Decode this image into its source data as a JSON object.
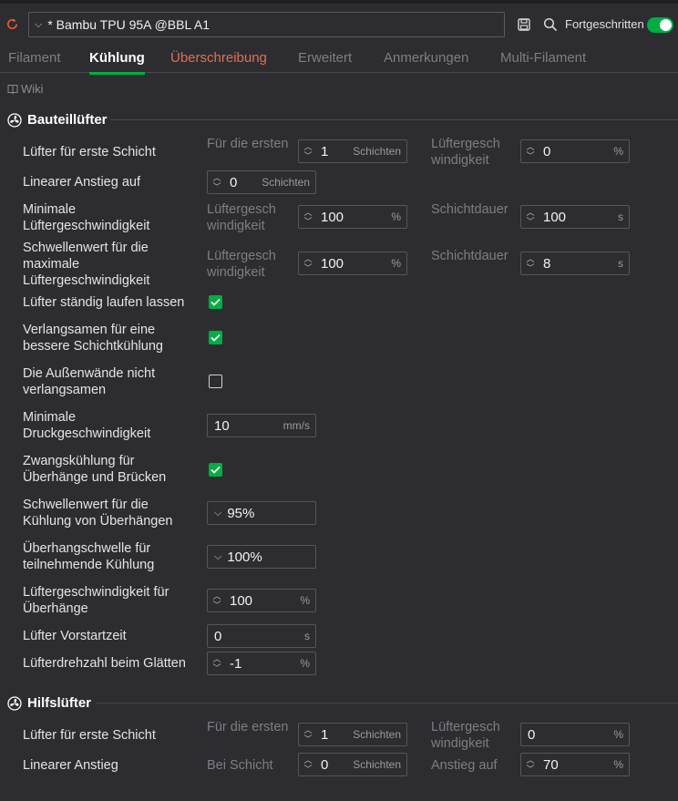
{
  "top": {
    "preset_name": "* Bambu TPU 95A @BBL A1",
    "advanced_label": "Fortgeschritten"
  },
  "tabs": [
    "Filament",
    "Kühlung",
    "Überschreibung",
    "Erweitert",
    "Anmerkungen",
    "Multi-Filament"
  ],
  "wiki": "Wiki",
  "section1": {
    "title": "Bauteillüfter",
    "first_layer_label": "Lüfter für erste Schicht",
    "first_layer_for": "Für die ersten",
    "first_layer_value": "1",
    "first_layer_unit": "Schichten",
    "first_layer_speed_label": "Lüftergeschwindigkeit",
    "first_layer_speed_value": "0",
    "first_layer_speed_unit": "%",
    "ramp_label": "Linearer Anstieg auf",
    "ramp_value": "0",
    "ramp_unit": "Schichten",
    "min_fan_label": "Minimale Lüftergeschwindigkeit",
    "min_fan_speed_label": "Lüftergeschwindigkeit",
    "min_fan_speed_value": "100",
    "min_fan_speed_unit": "%",
    "min_fan_layer_label": "Schichtdauer",
    "min_fan_layer_value": "100",
    "min_fan_layer_unit": "s",
    "max_fan_label": "Schwellenwert für die maximale Lüftergeschwindigkeit",
    "max_fan_speed_label": "Lüftergeschwindigkeit",
    "max_fan_speed_value": "100",
    "max_fan_speed_unit": "%",
    "max_fan_layer_label": "Schichtdauer",
    "max_fan_layer_value": "8",
    "max_fan_layer_unit": "s",
    "keep_fan_label": "Lüfter ständig laufen lassen",
    "keep_fan_checked": true,
    "slow_down_label": "Verlangsamen für eine bessere Schichtkühlung",
    "slow_down_checked": true,
    "no_slow_outer_label": "Die Außenwände nicht verlangsamen",
    "no_slow_outer_checked": false,
    "min_speed_label": "Minimale Druckgeschwindigkeit",
    "min_speed_value": "10",
    "min_speed_unit": "mm/s",
    "force_cooling_label": "Zwangskühlung für Überhänge und Brücken",
    "force_cooling_checked": true,
    "overhang_threshold_label": "Schwellenwert für die Kühlung von Überhängen",
    "overhang_threshold_value": "95%",
    "overhang_participate_label": "Überhangschwelle für teilnehmende Kühlung",
    "overhang_participate_value": "100%",
    "overhang_fan_label": "Lüftergeschwindigkeit für Überhänge",
    "overhang_fan_value": "100",
    "overhang_fan_unit": "%",
    "pre_start_label": "Lüfter Vorstartzeit",
    "pre_start_value": "0",
    "pre_start_unit": "s",
    "ironing_fan_label": "Lüfterdrehzahl beim Glätten",
    "ironing_fan_value": "-1",
    "ironing_fan_unit": "%"
  },
  "section2": {
    "title": "Hilfslüfter",
    "first_layer_label": "Lüfter für erste Schicht",
    "first_layer_for": "Für die ersten",
    "first_layer_value": "1",
    "first_layer_unit": "Schichten",
    "first_layer_speed_label": "Lüftergeschwindigkeit",
    "first_layer_speed_value": "0",
    "first_layer_speed_unit": "%",
    "ramp_label": "Linearer Anstieg",
    "ramp_at_label": "Bei Schicht",
    "ramp_at_value": "0",
    "ramp_at_unit": "Schichten",
    "ramp_to_label": "Anstieg auf",
    "ramp_to_value": "70",
    "ramp_to_unit": "%"
  },
  "colors": {
    "accent": "#00ae42",
    "warning": "#e07055",
    "background": "#2d2d31"
  },
  "icons": [
    "refresh-icon",
    "save-icon",
    "search-icon",
    "fan-icon",
    "book-icon",
    "chevron-down-icon",
    "checkmark-icon"
  ]
}
